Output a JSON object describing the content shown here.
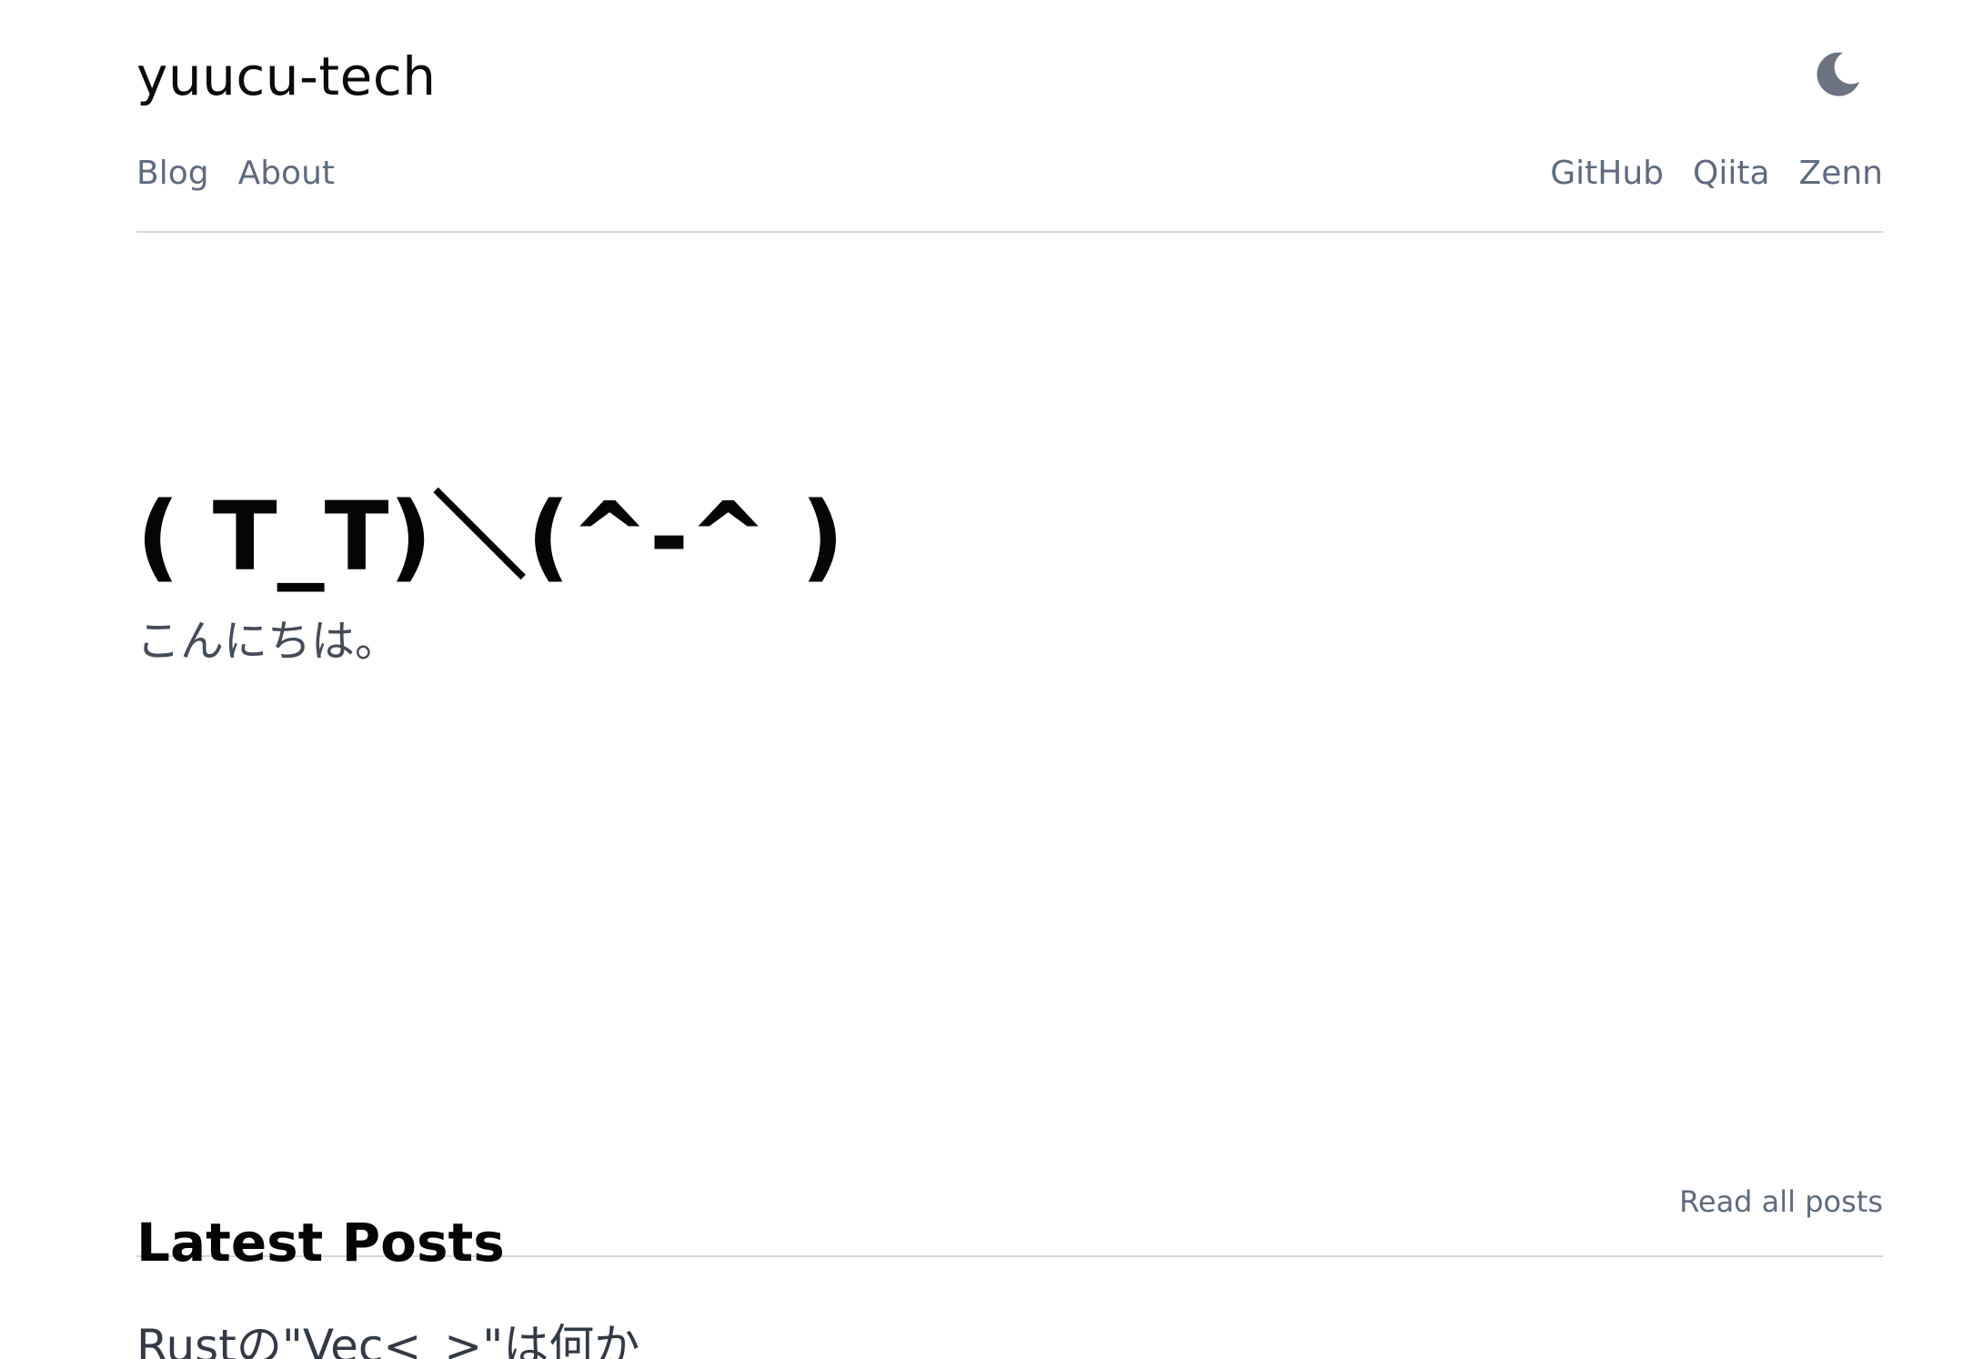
{
  "header": {
    "site_title": "yuucu-tech",
    "theme_toggle_icon": "moon-icon",
    "nav_left": [
      "Blog",
      "About"
    ],
    "nav_right": [
      "GitHub",
      "Qiita",
      "Zenn"
    ]
  },
  "hero": {
    "title": "( T_T)＼(^-^ )",
    "subtitle": "こんにちは。"
  },
  "latest_posts": {
    "heading": "Latest Posts",
    "read_all_label": "Read all posts",
    "items": [
      {
        "title": "Rustの\"Vec<_>\"は何か"
      }
    ]
  },
  "colors": {
    "text_primary": "#050505",
    "text_muted": "#5f6b7c",
    "divider": "#d5d8dd",
    "icon_gray": "#6b7280"
  }
}
